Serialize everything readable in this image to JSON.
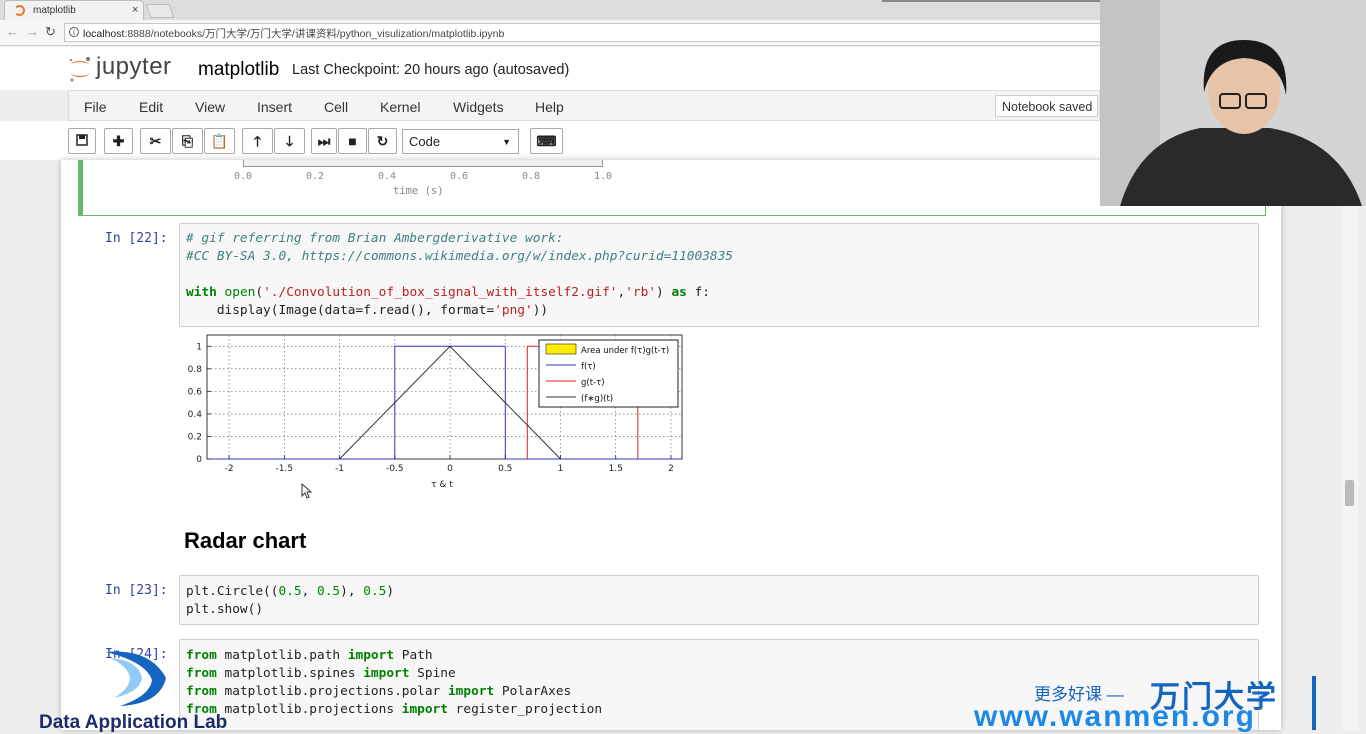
{
  "browser": {
    "tab_title": "matplotlib",
    "tab_close": "×",
    "url_host": "localhost",
    "url_path": ":8888/notebooks/万门大学/万门大学/讲课资料/python_visulization/matplotlib.ipynb"
  },
  "jupyter": {
    "logo_text": "jupyter",
    "notebook_name": "matplotlib",
    "checkpoint": "Last Checkpoint: 20 hours ago (autosaved)",
    "status": "Notebook saved",
    "menu": [
      "File",
      "Edit",
      "View",
      "Insert",
      "Cell",
      "Kernel",
      "Widgets",
      "Help"
    ],
    "cell_type": "Code",
    "toolbar_icons": [
      "save-icon",
      "plus-icon",
      "cut-icon",
      "copy-icon",
      "paste-icon",
      "arrow-up-icon",
      "arrow-down-icon",
      "step-forward-icon",
      "stop-icon",
      "restart-icon",
      "keyboard-icon"
    ]
  },
  "prev_output": {
    "ticks": [
      "0.0",
      "0.2",
      "0.4",
      "0.6",
      "0.8",
      "1.0"
    ],
    "xlabel": "time (s)"
  },
  "cells": [
    {
      "prompt": "In  [22]:",
      "lines": [
        "# gif referring from Brian Ambergderivative work:",
        "#CC BY-SA 3.0, https://commons.wikimedia.org/w/index.php?curid=11003835",
        "",
        "with open('./Convolution_of_box_signal_with_itself2.gif','rb') as f:",
        "    display(Image(data=f.read(), format='png'))"
      ]
    },
    {
      "prompt": "In  [23]:",
      "lines": [
        "plt.Circle((0.5, 0.5), 0.5)",
        "plt.show()"
      ]
    },
    {
      "prompt": "In  [24]:",
      "lines": [
        "from matplotlib.path import Path",
        "from matplotlib.spines import Spine",
        "from matplotlib.projections.polar import PolarAxes",
        "from matplotlib.projections import register_projection"
      ]
    }
  ],
  "heading": "Radar chart",
  "chart_data": {
    "type": "line",
    "x_ticks": [
      "-2",
      "-1.5",
      "-1",
      "-0.5",
      "0",
      "0.5",
      "1",
      "1.5",
      "2"
    ],
    "y_ticks": [
      "0",
      "0.2",
      "0.4",
      "0.6",
      "0.8",
      "1"
    ],
    "xlim": [
      -2.2,
      2.1
    ],
    "ylim": [
      0,
      1.1
    ],
    "xlabel": "τ & t",
    "grid": true,
    "legend_position": "top-right",
    "series": [
      {
        "name": "f(τ)",
        "color": "#3333cc",
        "x": [
          -2.2,
          -0.5,
          -0.5,
          0.5,
          0.5,
          2.1
        ],
        "y": [
          0,
          0,
          1,
          1,
          0,
          0
        ]
      },
      {
        "name": "g(t-τ)",
        "color": "#dd2222",
        "x": [
          0.7,
          0.7,
          1.7,
          1.7
        ],
        "y": [
          0,
          1,
          1,
          0
        ]
      },
      {
        "name": "(f∗g)(t)",
        "color": "#333333",
        "x": [
          -1,
          0,
          1
        ],
        "y": [
          0,
          1,
          0
        ]
      }
    ],
    "area_legend": {
      "name": "Area under f(τ)g(t-τ)",
      "color": "#ffee00"
    }
  },
  "watermarks": {
    "lab": "Data Application Lab",
    "cn_small": "更多好课 —",
    "cn_big": "万门大学",
    "url": "www.wanmen.org"
  }
}
